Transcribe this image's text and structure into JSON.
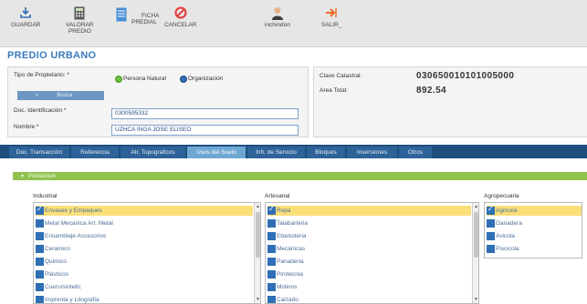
{
  "toolbar": {
    "guardar": "GUARDAR",
    "valorar_1": "VALORAR",
    "valorar_2": "PREDIO",
    "ficha_1": "FICHA",
    "ficha_2": "PREDIAL",
    "cancelar": "CANCELAR",
    "user": "inchindon",
    "salir": "SALIR_"
  },
  "page_title": "PREDIO URBANO",
  "form": {
    "tipo_label": "Tipo de Propietario: *",
    "radio_natural": "Persona Natural",
    "radio_org": "Organización",
    "search_label": "Busca",
    "doc_label": "Doc. Identificación *",
    "doc_value": "0300595332",
    "nombre_label": "Nombre *",
    "nombre_value": "UZHCA INGA JOSE ELISEO",
    "clave_label": "Clave Catastral:",
    "clave_value": "030650010101005000",
    "area_label": "Area Total:",
    "area_value": "892.54"
  },
  "tabs": [
    "Doc. Transacción",
    "Referencia",
    "Atr. Topograficos",
    "Usos del Suelo",
    "Infr. de Servicio",
    "Bloques",
    "Inversiones",
    "Otros"
  ],
  "active_tab": "Usos del Suelo",
  "section": "Produccion",
  "columns": {
    "industrial": {
      "title": "Industrial",
      "items": [
        "Envases y Empaques",
        "Metal Mecanica Art. Metal",
        "Ensamblaje Accesorios",
        "Ceramico",
        "Quimico",
        "Plásticos",
        "Cuero/sintetic",
        "Imprenta y Litografía"
      ]
    },
    "artesanal": {
      "title": "Artesanal",
      "items": [
        "Ropa",
        "Talabarteria",
        "Ebanisteria",
        "Mecánicas",
        "Panaderia",
        "Pirotecnia",
        "Molinos",
        "Calzado"
      ]
    },
    "agropecuaria": {
      "title": "Agropecuaria",
      "items": [
        "Agricola",
        "Ganadera",
        "Avicola",
        "Piscicola"
      ]
    }
  },
  "colors": {
    "accent": "#3a7bbd",
    "tab_bar": "#1f4f7e",
    "active_tab": "#6fa7d3",
    "section": "#8fc34b",
    "selected_row": "#fbe07a"
  }
}
